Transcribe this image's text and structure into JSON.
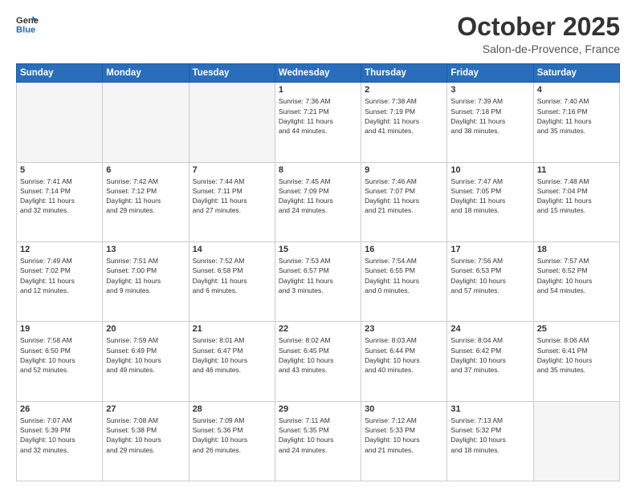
{
  "header": {
    "logo_line1": "General",
    "logo_line2": "Blue",
    "month": "October 2025",
    "location": "Salon-de-Provence, France"
  },
  "weekdays": [
    "Sunday",
    "Monday",
    "Tuesday",
    "Wednesday",
    "Thursday",
    "Friday",
    "Saturday"
  ],
  "weeks": [
    [
      {
        "day": "",
        "info": ""
      },
      {
        "day": "",
        "info": ""
      },
      {
        "day": "",
        "info": ""
      },
      {
        "day": "1",
        "info": "Sunrise: 7:36 AM\nSunset: 7:21 PM\nDaylight: 11 hours\nand 44 minutes."
      },
      {
        "day": "2",
        "info": "Sunrise: 7:38 AM\nSunset: 7:19 PM\nDaylight: 11 hours\nand 41 minutes."
      },
      {
        "day": "3",
        "info": "Sunrise: 7:39 AM\nSunset: 7:18 PM\nDaylight: 11 hours\nand 38 minutes."
      },
      {
        "day": "4",
        "info": "Sunrise: 7:40 AM\nSunset: 7:16 PM\nDaylight: 11 hours\nand 35 minutes."
      }
    ],
    [
      {
        "day": "5",
        "info": "Sunrise: 7:41 AM\nSunset: 7:14 PM\nDaylight: 11 hours\nand 32 minutes."
      },
      {
        "day": "6",
        "info": "Sunrise: 7:42 AM\nSunset: 7:12 PM\nDaylight: 11 hours\nand 29 minutes."
      },
      {
        "day": "7",
        "info": "Sunrise: 7:44 AM\nSunset: 7:11 PM\nDaylight: 11 hours\nand 27 minutes."
      },
      {
        "day": "8",
        "info": "Sunrise: 7:45 AM\nSunset: 7:09 PM\nDaylight: 11 hours\nand 24 minutes."
      },
      {
        "day": "9",
        "info": "Sunrise: 7:46 AM\nSunset: 7:07 PM\nDaylight: 11 hours\nand 21 minutes."
      },
      {
        "day": "10",
        "info": "Sunrise: 7:47 AM\nSunset: 7:05 PM\nDaylight: 11 hours\nand 18 minutes."
      },
      {
        "day": "11",
        "info": "Sunrise: 7:48 AM\nSunset: 7:04 PM\nDaylight: 11 hours\nand 15 minutes."
      }
    ],
    [
      {
        "day": "12",
        "info": "Sunrise: 7:49 AM\nSunset: 7:02 PM\nDaylight: 11 hours\nand 12 minutes."
      },
      {
        "day": "13",
        "info": "Sunrise: 7:51 AM\nSunset: 7:00 PM\nDaylight: 11 hours\nand 9 minutes."
      },
      {
        "day": "14",
        "info": "Sunrise: 7:52 AM\nSunset: 6:58 PM\nDaylight: 11 hours\nand 6 minutes."
      },
      {
        "day": "15",
        "info": "Sunrise: 7:53 AM\nSunset: 6:57 PM\nDaylight: 11 hours\nand 3 minutes."
      },
      {
        "day": "16",
        "info": "Sunrise: 7:54 AM\nSunset: 6:55 PM\nDaylight: 11 hours\nand 0 minutes."
      },
      {
        "day": "17",
        "info": "Sunrise: 7:56 AM\nSunset: 6:53 PM\nDaylight: 10 hours\nand 57 minutes."
      },
      {
        "day": "18",
        "info": "Sunrise: 7:57 AM\nSunset: 6:52 PM\nDaylight: 10 hours\nand 54 minutes."
      }
    ],
    [
      {
        "day": "19",
        "info": "Sunrise: 7:58 AM\nSunset: 6:50 PM\nDaylight: 10 hours\nand 52 minutes."
      },
      {
        "day": "20",
        "info": "Sunrise: 7:59 AM\nSunset: 6:49 PM\nDaylight: 10 hours\nand 49 minutes."
      },
      {
        "day": "21",
        "info": "Sunrise: 8:01 AM\nSunset: 6:47 PM\nDaylight: 10 hours\nand 46 minutes."
      },
      {
        "day": "22",
        "info": "Sunrise: 8:02 AM\nSunset: 6:45 PM\nDaylight: 10 hours\nand 43 minutes."
      },
      {
        "day": "23",
        "info": "Sunrise: 8:03 AM\nSunset: 6:44 PM\nDaylight: 10 hours\nand 40 minutes."
      },
      {
        "day": "24",
        "info": "Sunrise: 8:04 AM\nSunset: 6:42 PM\nDaylight: 10 hours\nand 37 minutes."
      },
      {
        "day": "25",
        "info": "Sunrise: 8:06 AM\nSunset: 6:41 PM\nDaylight: 10 hours\nand 35 minutes."
      }
    ],
    [
      {
        "day": "26",
        "info": "Sunrise: 7:07 AM\nSunset: 5:39 PM\nDaylight: 10 hours\nand 32 minutes."
      },
      {
        "day": "27",
        "info": "Sunrise: 7:08 AM\nSunset: 5:38 PM\nDaylight: 10 hours\nand 29 minutes."
      },
      {
        "day": "28",
        "info": "Sunrise: 7:09 AM\nSunset: 5:36 PM\nDaylight: 10 hours\nand 26 minutes."
      },
      {
        "day": "29",
        "info": "Sunrise: 7:11 AM\nSunset: 5:35 PM\nDaylight: 10 hours\nand 24 minutes."
      },
      {
        "day": "30",
        "info": "Sunrise: 7:12 AM\nSunset: 5:33 PM\nDaylight: 10 hours\nand 21 minutes."
      },
      {
        "day": "31",
        "info": "Sunrise: 7:13 AM\nSunset: 5:32 PM\nDaylight: 10 hours\nand 18 minutes."
      },
      {
        "day": "",
        "info": ""
      }
    ]
  ]
}
